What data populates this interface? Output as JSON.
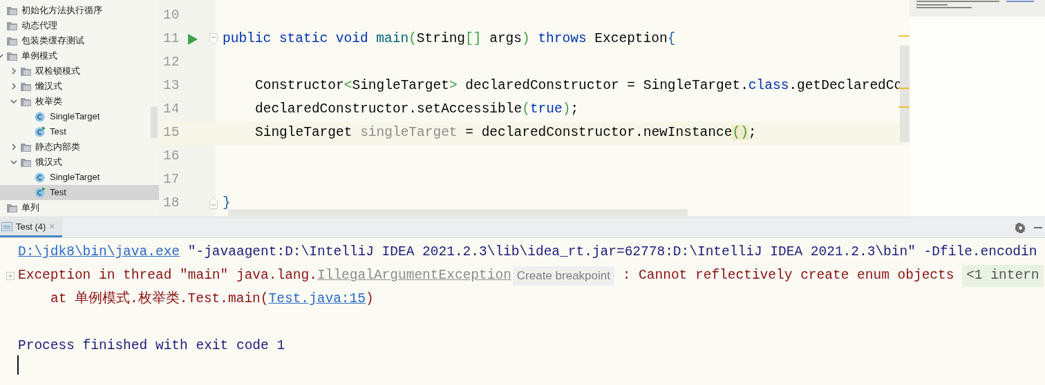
{
  "project_tree": [
    {
      "label": "初始化方法执行循序",
      "kind": "folder",
      "selected": false
    },
    {
      "label": "动态代理",
      "kind": "folder",
      "selected": false
    },
    {
      "label": "包装类缓存测试",
      "kind": "folder",
      "selected": false
    },
    {
      "label": "单例模式",
      "kind": "folder",
      "selected": false,
      "expanded": true,
      "children": [
        {
          "label": "双检锁模式",
          "kind": "folder",
          "selected": false,
          "expanded": false
        },
        {
          "label": "懒汉式",
          "kind": "folder",
          "selected": false,
          "expanded": false
        },
        {
          "label": "枚举类",
          "kind": "folder",
          "selected": false,
          "expanded": true,
          "children": [
            {
              "label": "SingleTarget",
              "kind": "class",
              "selected": false
            },
            {
              "label": "Test",
              "kind": "main_class",
              "selected": false
            }
          ]
        },
        {
          "label": "静态内部类",
          "kind": "folder",
          "selected": false,
          "expanded": false
        },
        {
          "label": "饿汉式",
          "kind": "folder",
          "selected": false,
          "expanded": true,
          "children": [
            {
              "label": "SingleTarget",
              "kind": "class",
              "selected": false
            },
            {
              "label": "Test",
              "kind": "main_class",
              "selected": true
            }
          ]
        }
      ]
    },
    {
      "label": "单列",
      "kind": "folder",
      "selected": false
    }
  ],
  "editor": {
    "lines": [
      {
        "number": "10",
        "current": false
      },
      {
        "number": "11",
        "current": false,
        "run": true,
        "fold_open": true,
        "tokens": [
          {
            "kind": "keyword",
            "text": "public static void "
          },
          {
            "kind": "method",
            "text": "main"
          },
          {
            "kind": "bracket",
            "text": "("
          },
          {
            "kind": "plain",
            "text": "String"
          },
          {
            "kind": "bracket",
            "text": "[]"
          },
          {
            "kind": "plain",
            "text": " args"
          },
          {
            "kind": "bracket",
            "text": ")"
          },
          {
            "kind": "keyword",
            "text": " throws "
          },
          {
            "kind": "plain",
            "text": "Exception"
          },
          {
            "kind": "brace",
            "text": "{"
          }
        ]
      },
      {
        "number": "12",
        "current": false
      },
      {
        "number": "13",
        "current": false,
        "indented": true,
        "tokens": [
          {
            "kind": "plain",
            "text": "Constructor"
          },
          {
            "kind": "bracket",
            "text": "<"
          },
          {
            "kind": "plain",
            "text": "SingleTarget"
          },
          {
            "kind": "bracket",
            "text": ">"
          },
          {
            "kind": "plain",
            "text": " declaredConstructor = SingleTarget."
          },
          {
            "kind": "keyword",
            "text": "class"
          },
          {
            "kind": "plain",
            "text": ".getDeclaredCo"
          }
        ]
      },
      {
        "number": "14",
        "current": false,
        "indented": true,
        "tokens": [
          {
            "kind": "plain",
            "text": "declaredConstructor.setAccessible"
          },
          {
            "kind": "bracket",
            "text": "("
          },
          {
            "kind": "keyword",
            "text": "true"
          },
          {
            "kind": "bracket",
            "text": ")"
          },
          {
            "kind": "plain",
            "text": ";"
          }
        ]
      },
      {
        "number": "15",
        "current": true,
        "indented": true,
        "tokens": [
          {
            "kind": "plain",
            "text": "SingleTarget "
          },
          {
            "kind": "unused",
            "text": "singleTarget"
          },
          {
            "kind": "plain",
            "text": " = declaredConstructor.newInstance"
          },
          {
            "kind": "matched",
            "text": "()"
          },
          {
            "kind": "plain",
            "text": ";"
          }
        ]
      },
      {
        "number": "16",
        "current": false
      },
      {
        "number": "17",
        "current": false
      },
      {
        "number": "18",
        "current": false,
        "fold_close": true,
        "tokens": [
          {
            "kind": "brace",
            "text": "}"
          }
        ]
      }
    ]
  },
  "run_panel": {
    "tabs": [
      {
        "label": "Test (4)",
        "close": "×",
        "selected": true
      }
    ],
    "console": [
      {
        "kind": "output",
        "tokens": [
          {
            "kind": "path_link",
            "text": "D:\\jdk8\\bin\\java.exe"
          },
          {
            "kind": "command",
            "text": " \"-javaagent:D:\\IntelliJ IDEA 2021.2.3\\lib\\idea_rt.jar=62778:D:\\IntelliJ IDEA 2021.2.3\\bin\" -Dfile.encodin"
          }
        ]
      },
      {
        "kind": "output",
        "foldable": true,
        "tokens": [
          {
            "kind": "error",
            "text": "Exception in thread \"main\" java.lang."
          },
          {
            "kind": "exception_link",
            "text": "IllegalArgumentException"
          },
          {
            "kind": "hint",
            "text": "Create breakpoint"
          },
          {
            "kind": "error",
            "text": " : Cannot reflectively create enum objects "
          },
          {
            "kind": "folded",
            "text": "<1 intern"
          }
        ]
      },
      {
        "kind": "output",
        "indented": true,
        "tokens": [
          {
            "kind": "error",
            "text": "at 单例模式.枚举类.Test.main("
          },
          {
            "kind": "source_link",
            "text": "Test.java:15"
          },
          {
            "kind": "error",
            "text": ")"
          }
        ]
      },
      {
        "kind": "blank"
      },
      {
        "kind": "output",
        "tokens": [
          {
            "kind": "info",
            "text": "Process finished with exit code 1"
          }
        ]
      }
    ]
  }
}
